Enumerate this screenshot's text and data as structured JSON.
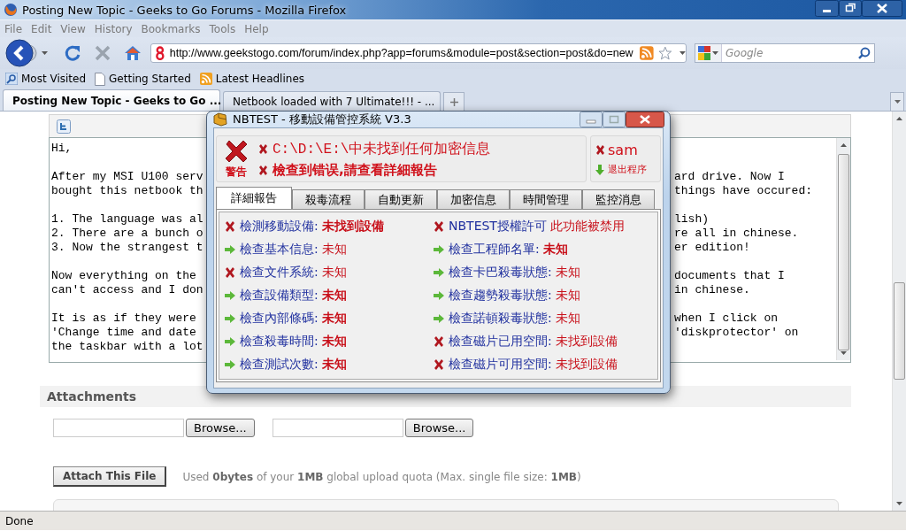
{
  "window": {
    "title": "Posting New Topic - Geeks to Go Forums - Mozilla Firefox"
  },
  "menu": [
    "File",
    "Edit",
    "View",
    "History",
    "Bookmarks",
    "Tools",
    "Help"
  ],
  "address": {
    "value": "http://www.geekstogo.com/forum/index.php?app=forums&module=post&section=post&do=new"
  },
  "search": {
    "placeholder": "Google"
  },
  "bookmarks": [
    {
      "kind": "search",
      "label": "Most Visited"
    },
    {
      "kind": "page",
      "label": "Getting Started"
    },
    {
      "kind": "feed",
      "label": "Latest Headlines"
    }
  ],
  "tabs": [
    {
      "label": "Posting New Topic - Geeks to Go ...",
      "selected": true
    },
    {
      "label": "Netbook loaded with 7 Ultimate!!! - ...",
      "selected": false
    }
  ],
  "editor": {
    "paragraphs": [
      [
        {
          "left": "Hi,"
        }
      ],
      [
        {
          "left": "After my MSI U100 serv",
          "right": "ard drive. Now I"
        },
        {
          "left": "bought this netbook th",
          "right": "things have occured:"
        }
      ],
      [
        {
          "left": "1. The language was al",
          "right": "lish)"
        },
        {
          "left": "2. There are a bunch o",
          "right": "re all in chinese."
        },
        {
          "left": "3. Now the strangest t",
          "right": "er edition!"
        }
      ],
      [
        {
          "left": "Now everything on the",
          "right": "documents that I"
        },
        {
          "left": "can't access and I don",
          "right": "in chinese."
        }
      ],
      [
        {
          "left": "It is as if they were",
          "right": "when I click on"
        },
        {
          "left": "'Change time and date",
          "right": "'diskprotector' on"
        },
        {
          "left": "the taskbar with a lot"
        }
      ]
    ]
  },
  "attachments": {
    "title": "Attachments",
    "browse_buttons": [
      "Browse...",
      "Browse..."
    ],
    "attach_button": "Attach This File",
    "quota": "Used **0bytes** of your **1MB** global upload quota (Max. single file size: **1MB**)"
  },
  "status_bar": "Done",
  "dialog": {
    "title": "NBTEST - 移動設備管控系統 V3.3",
    "warning": "警告",
    "messages": [
      {
        "text": "C:\\D:\\E:\\中未找到任何加密信息",
        "bold": false
      },
      {
        "text": "檢查到错误,請查看詳細報告",
        "bold": true
      }
    ],
    "user": "sam",
    "exit": "退出程序",
    "tabs": [
      {
        "label": "詳細報告",
        "selected": true
      },
      {
        "label": "殺毒流程",
        "selected": false
      },
      {
        "label": "自動更新",
        "selected": false
      },
      {
        "label": "加密信息",
        "selected": false
      },
      {
        "label": "時間管理",
        "selected": false
      },
      {
        "label": "監控消息",
        "selected": false
      }
    ],
    "checks_left": [
      {
        "kind": "fail",
        "label": "檢測移動設備:",
        "value": "未找到設備",
        "bold": true
      },
      {
        "kind": "ok",
        "label": "檢查基本信息:",
        "value": "未知",
        "bold": false
      },
      {
        "kind": "fail",
        "label": "檢查文件系統:",
        "value": "未知",
        "bold": false
      },
      {
        "kind": "ok",
        "label": "檢查設備類型:",
        "value": "未知",
        "bold": true
      },
      {
        "kind": "ok",
        "label": "檢查內部條碼:",
        "value": "未知",
        "bold": true
      },
      {
        "kind": "ok",
        "label": "檢查殺毒時間:",
        "value": "未知",
        "bold": true
      },
      {
        "kind": "ok",
        "label": "檢查測試次數:",
        "value": "未知",
        "bold": true
      }
    ],
    "checks_right": [
      {
        "kind": "fail",
        "label": "NBTEST授權許可",
        "value": "此功能被禁用",
        "bold": false
      },
      {
        "kind": "ok",
        "label": "檢查工程師名單:",
        "value": "未知",
        "bold": true
      },
      {
        "kind": "ok",
        "label": "檢查卡巴殺毒狀態:",
        "value": "未知",
        "bold": false
      },
      {
        "kind": "ok",
        "label": "檢查趨勢殺毒狀態:",
        "value": "未知",
        "bold": false
      },
      {
        "kind": "ok",
        "label": "檢查諾頓殺毒狀態:",
        "value": "未知",
        "bold": false
      },
      {
        "kind": "fail",
        "label": "檢查磁片已用空間:",
        "value": "未找到設備",
        "bold": false
      },
      {
        "kind": "fail",
        "label": "檢查磁片可用空間:",
        "value": "未找到設備",
        "bold": false
      }
    ]
  }
}
